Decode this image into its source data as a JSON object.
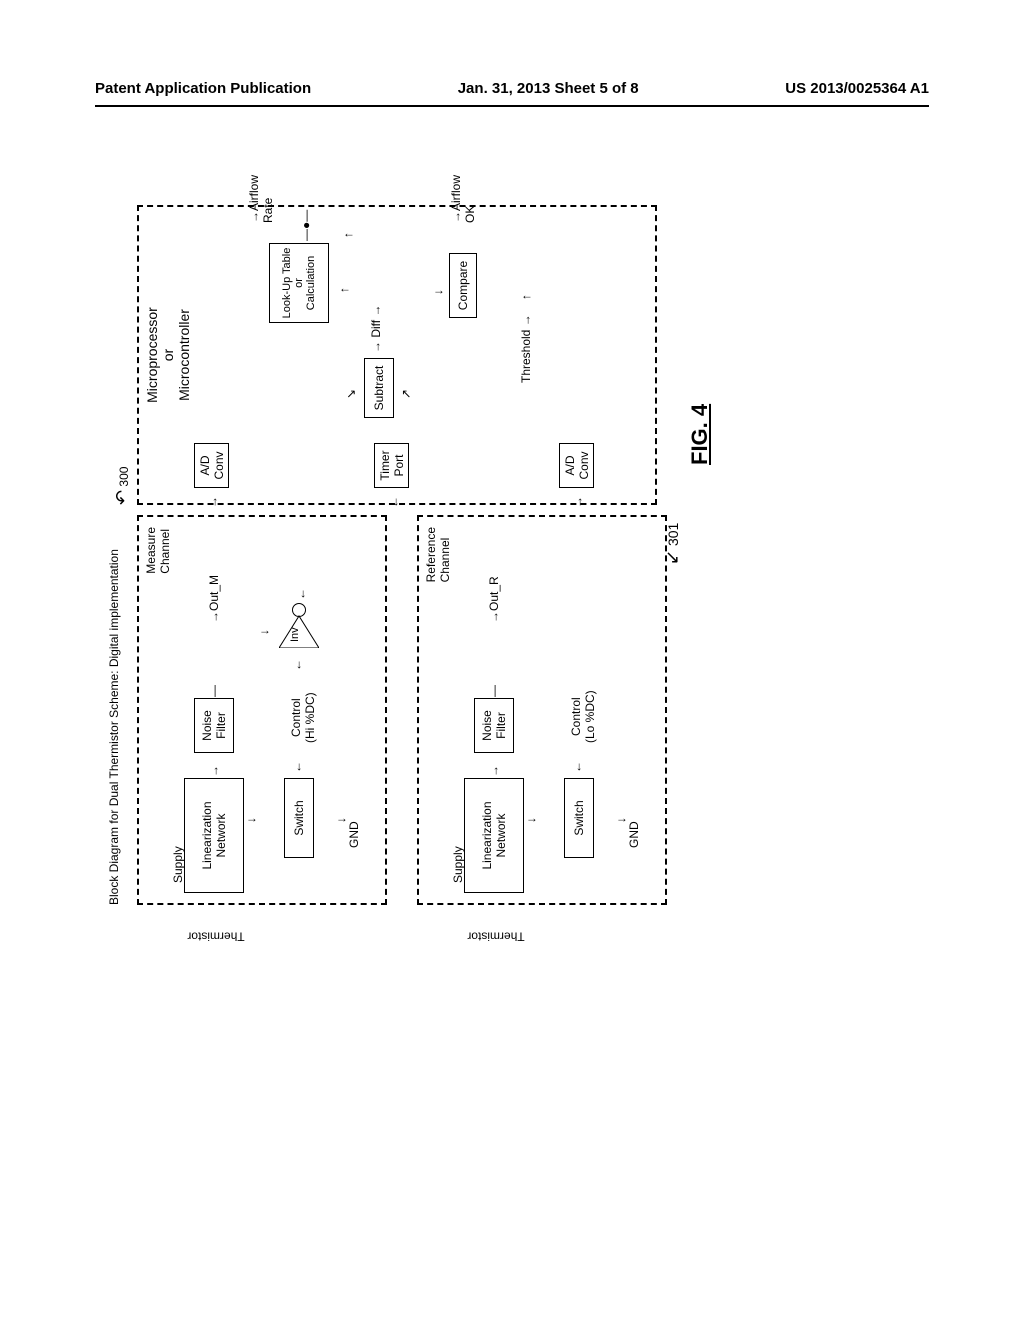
{
  "header": {
    "left": "Patent Application Publication",
    "center": "Jan. 31, 2013   Sheet 5 of 8",
    "right": "US 2013/0025364 A1"
  },
  "diagram": {
    "title": "Block Diagram for Dual Thermistor Scheme: Digital implementation",
    "ref_300": "300",
    "ref_301": "301",
    "figure_label": "FIG. 4",
    "measure_channel": {
      "label": "Measure\nChannel",
      "supply": "Supply",
      "thermistor": "Thermistor",
      "linearization_network": "Linearization\nNetwork",
      "noise_filter": "Noise\nFilter",
      "switch": "Switch",
      "gnd": "GND",
      "control": "Control\n(Hi %DC)",
      "inv": "Inv",
      "out": "Out_M"
    },
    "reference_channel": {
      "label": "Reference\nChannel",
      "supply": "Supply",
      "thermistor": "Thermistor",
      "linearization_network": "Linearization\nNetwork",
      "noise_filter": "Noise\nFilter",
      "switch": "Switch",
      "gnd": "GND",
      "control": "Control\n(Lo %DC)",
      "out": "Out_R"
    },
    "mcu": {
      "title": "Microprocessor\nor\nMicrocontroller",
      "ad_conv_m": "A/D\nConv",
      "ad_conv_r": "A/D\nConv",
      "timer_port": "Timer\nPort",
      "subtract": "Subtract",
      "diff": "Diff",
      "lookup": "Look-Up Table\nor\nCalculation",
      "compare": "Compare",
      "threshold": "Threshold",
      "airflow_rate": "Airflow\nRate",
      "airflow_ok": "Airflow\nOK"
    }
  }
}
